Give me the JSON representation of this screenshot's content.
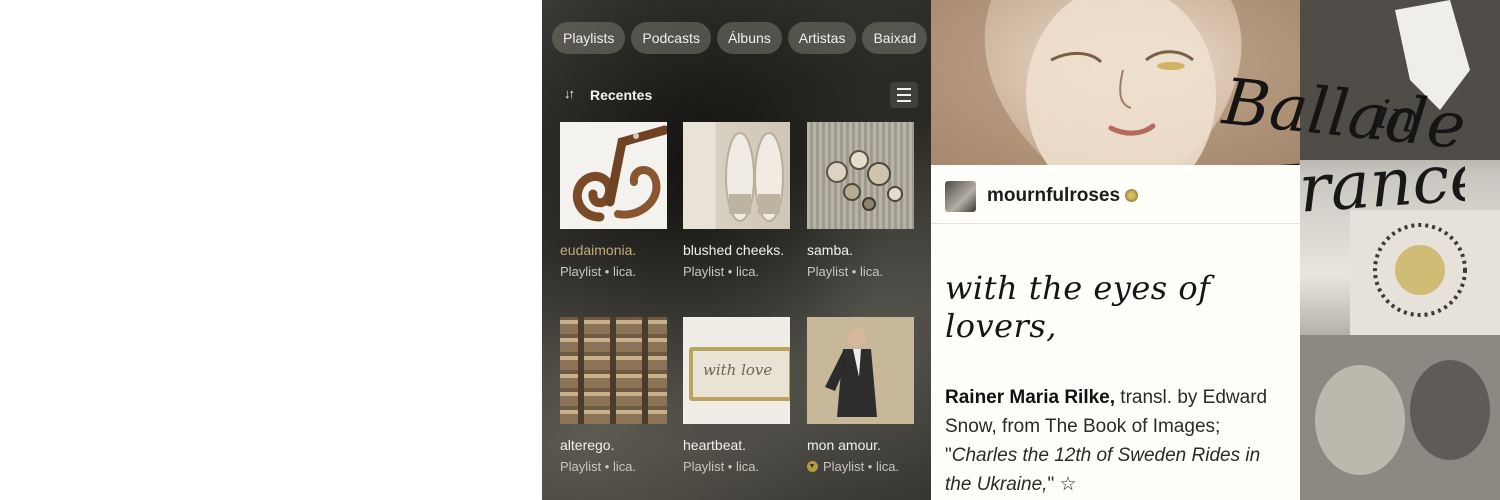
{
  "app": {
    "chips": [
      "Playlists",
      "Podcasts",
      "Álbuns",
      "Artistas",
      "Baixad"
    ],
    "sort_label": "Recentes",
    "tiles": [
      {
        "title": "eudaimonia.",
        "subtitle": "Playlist • lica.",
        "active": true
      },
      {
        "title": "blushed cheeks.",
        "subtitle": "Playlist • lica."
      },
      {
        "title": "samba.",
        "subtitle": "Playlist • lica."
      },
      {
        "title": "alterego.",
        "subtitle": "Playlist • lica."
      },
      {
        "title": "heartbeat.",
        "subtitle": "Playlist • lica."
      },
      {
        "title": "mon amour.",
        "subtitle": "Playlist • lica.",
        "downloaded": true
      }
    ],
    "keychain_text": "with love",
    "colors": {
      "active_title": "#c2ad78",
      "accent_download": "#b59a44"
    }
  },
  "collage": {
    "handwriting": "Ballade in France",
    "post": {
      "username": "mournfulroses",
      "quote": "with the eyes of lovers,",
      "author": "Rainer Maria Rilke,",
      "caption_mid": " transl. by Edward Snow, from The Book of Images; \"",
      "caption_title": "Charles the 12th of Sweden Rides in the Ukraine,",
      "caption_end": "\" ☆"
    }
  }
}
